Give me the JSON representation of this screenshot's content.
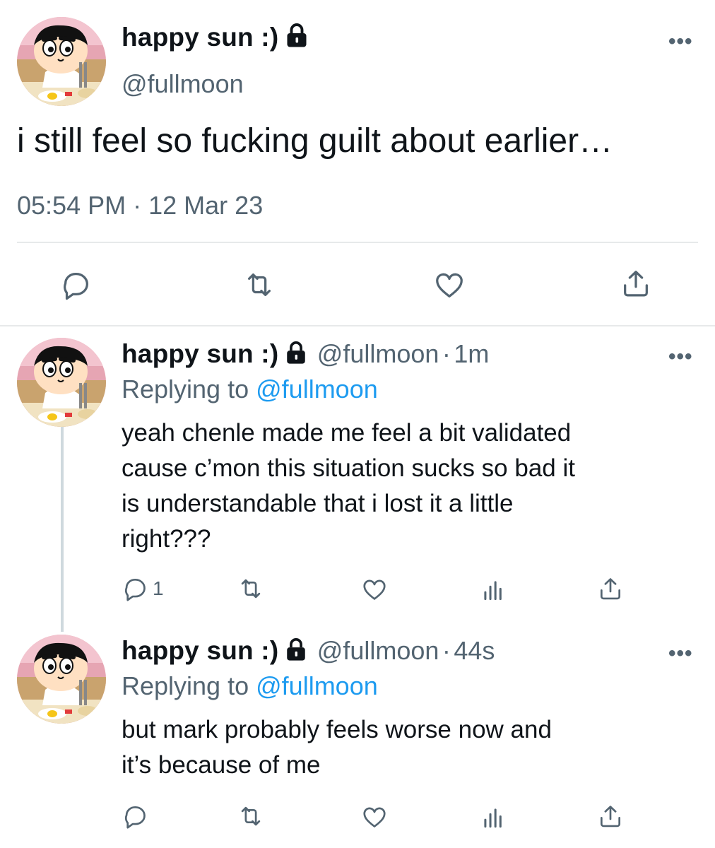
{
  "main_tweet": {
    "display_name": "happy sun :)",
    "handle": "@fullmoon",
    "text": "i still feel so fucking guilt about earlier…",
    "time": "05:54 PM",
    "separator": "·",
    "date": "12 Mar 23",
    "more_label": "•••"
  },
  "replies": [
    {
      "display_name": "happy sun :)",
      "handle": "@fullmoon",
      "separator": "·",
      "age": "1m",
      "replying_prefix": "Replying to",
      "replying_handle": "@fullmoon",
      "text_lines": [
        "yeah chenle made me feel a bit validated",
        "cause c’mon this situation sucks so bad it",
        "is understandable that i lost it a little",
        "right???"
      ],
      "reply_count": "1",
      "more_label": "•••"
    },
    {
      "display_name": "happy sun :)",
      "handle": "@fullmoon",
      "separator": "·",
      "age": "44s",
      "replying_prefix": "Replying to",
      "replying_handle": "@fullmoon",
      "text_lines": [
        "but mark probably feels worse now and",
        "it’s because of me"
      ],
      "reply_count": "",
      "more_label": "•••"
    }
  ],
  "icons": {
    "reply": "reply-icon",
    "retweet": "retweet-icon",
    "like": "like-icon",
    "views": "views-icon",
    "share": "share-icon",
    "lock": "lock-icon",
    "more": "more-icon"
  },
  "colors": {
    "text": "#0f1419",
    "secondary": "#536471",
    "accent": "#1d9bf0",
    "divider": "#e7e9ea",
    "thread_line": "#cfd9de"
  }
}
